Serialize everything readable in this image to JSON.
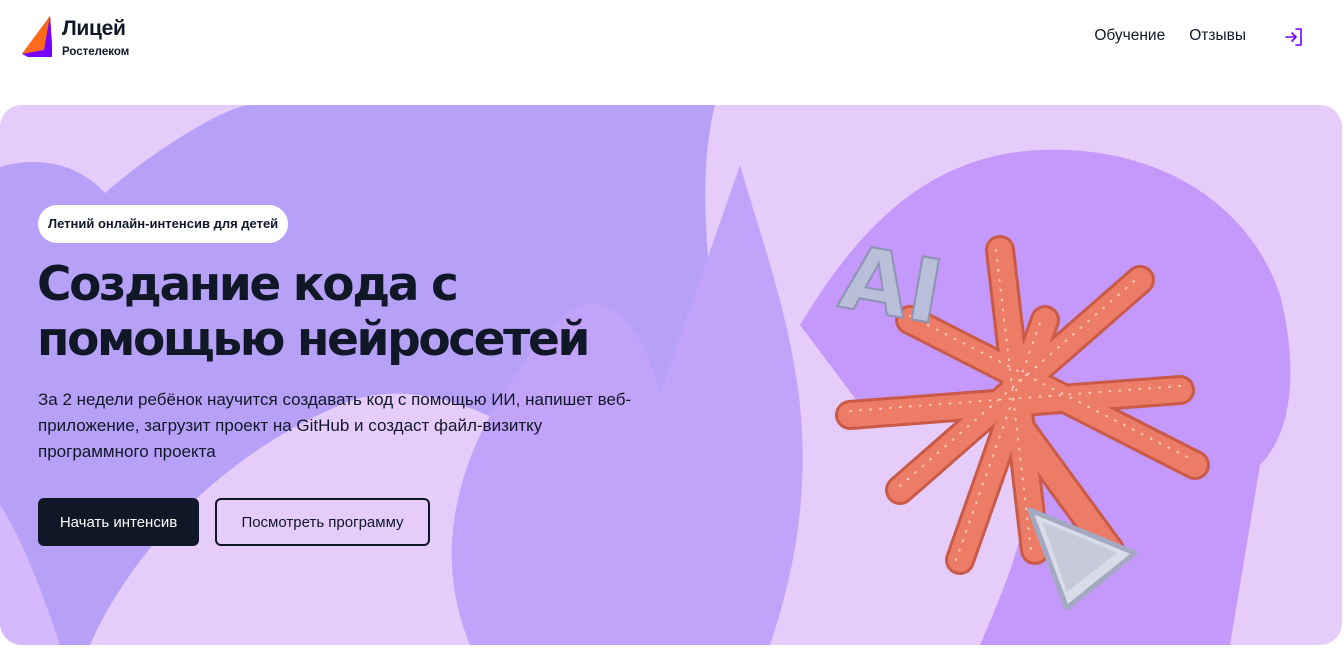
{
  "header": {
    "logo": {
      "title": "Лицей",
      "subtitle": "Ростелеком",
      "icon": "rostelecom-logo-icon"
    },
    "nav": [
      {
        "label": "Обучение"
      },
      {
        "label": "Отзывы"
      }
    ],
    "login_icon": "login-icon"
  },
  "hero": {
    "badge": "Летний онлайн-интенсив для детей",
    "title_line1": "Создание кода с",
    "title_line2": "помощью нейросетей",
    "description": "За 2 недели ребёнок научится создавать код с помощью ИИ, напишет веб-приложение, загрузит проект на GitHub и создаст файл-визитку программного проекта",
    "primary_button": "Начать интенсив",
    "secondary_button": "Посмотреть программу",
    "illustration": {
      "icon": "star-sculpture-icon",
      "text": "AI"
    }
  },
  "colors": {
    "dark": "#101828",
    "accent": "#7700ff",
    "hero_light": "#e5ccfb",
    "hero_purple": "#b7a1f8",
    "star": "#e8735f"
  }
}
